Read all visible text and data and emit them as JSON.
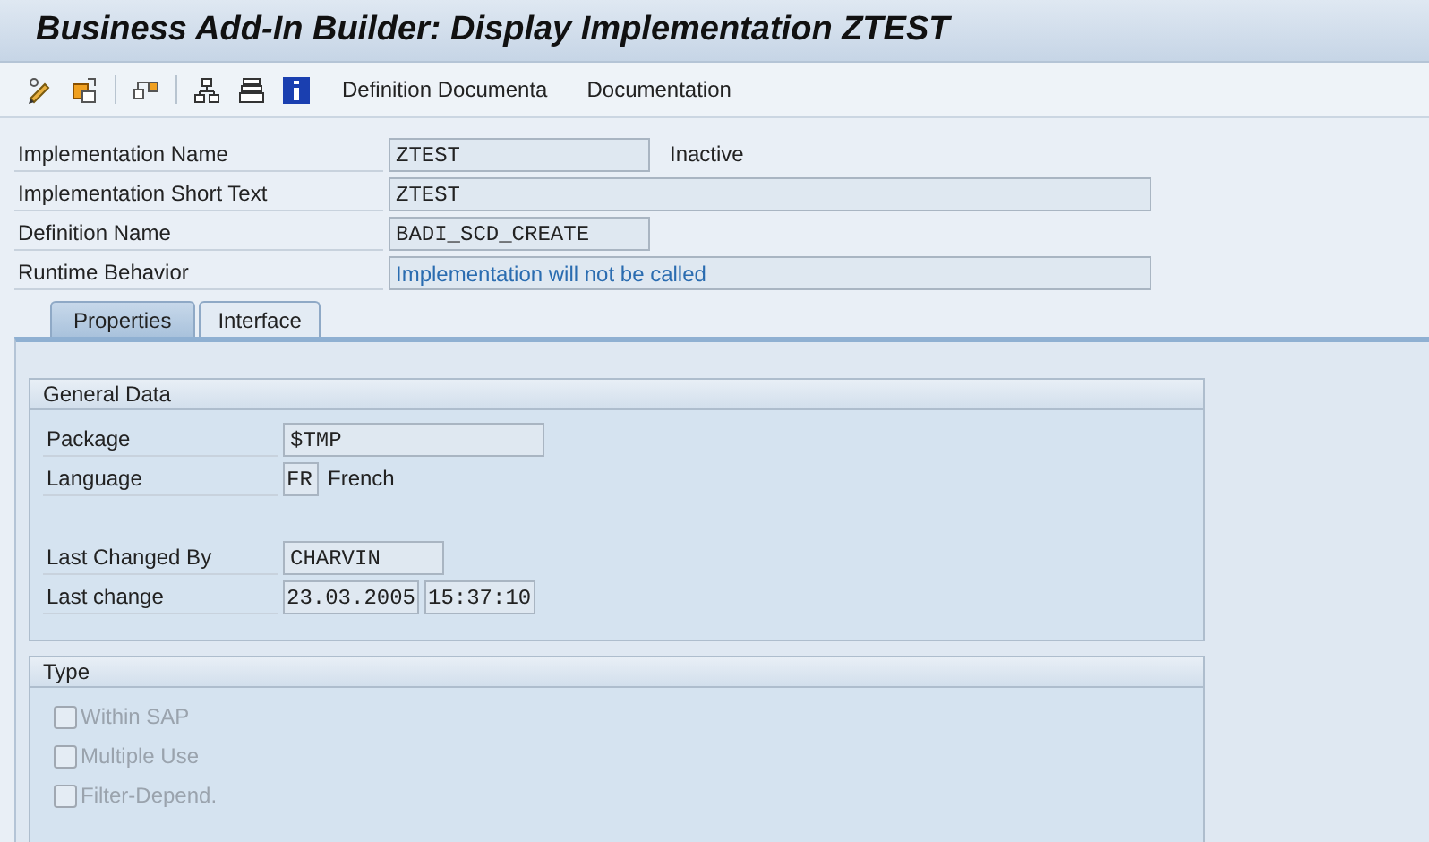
{
  "window": {
    "title": "Business Add-In Builder: Display Implementation ZTEST"
  },
  "toolbar": {
    "buttons": [
      "Definition Documenta",
      "Documentation"
    ]
  },
  "header_fields": [
    {
      "label": "Implementation Name",
      "value": "ZTEST",
      "note": "Inactive"
    },
    {
      "label": "Implementation Short Text",
      "value": "ZTEST"
    },
    {
      "label": "Definition Name",
      "value": "BADI_SCD_CREATE"
    },
    {
      "label": "Runtime Behavior",
      "value": "Implementation will not be called",
      "kind": "info"
    }
  ],
  "tabs": [
    {
      "label": "Properties",
      "selected": true
    },
    {
      "label": "Interface",
      "selected": false
    }
  ],
  "general_data": {
    "title": "General Data",
    "rows": [
      {
        "label": "Package",
        "values": [
          "$TMP"
        ]
      },
      {
        "label": "Language",
        "values": [
          "FR"
        ],
        "note": "French"
      },
      {
        "kind": "spacer"
      },
      {
        "label": "Last Changed By",
        "values": [
          "CHARVIN"
        ]
      },
      {
        "label": "Last change",
        "values": [
          "23.03.2005",
          "15:37:10"
        ]
      }
    ]
  },
  "type": {
    "title": "Type",
    "options": [
      {
        "label": "Within SAP",
        "checked": false,
        "disabled": true
      },
      {
        "label": "Multiple Use",
        "checked": false,
        "disabled": true
      },
      {
        "label": "Filter-Depend.",
        "checked": false,
        "disabled": true
      }
    ]
  }
}
